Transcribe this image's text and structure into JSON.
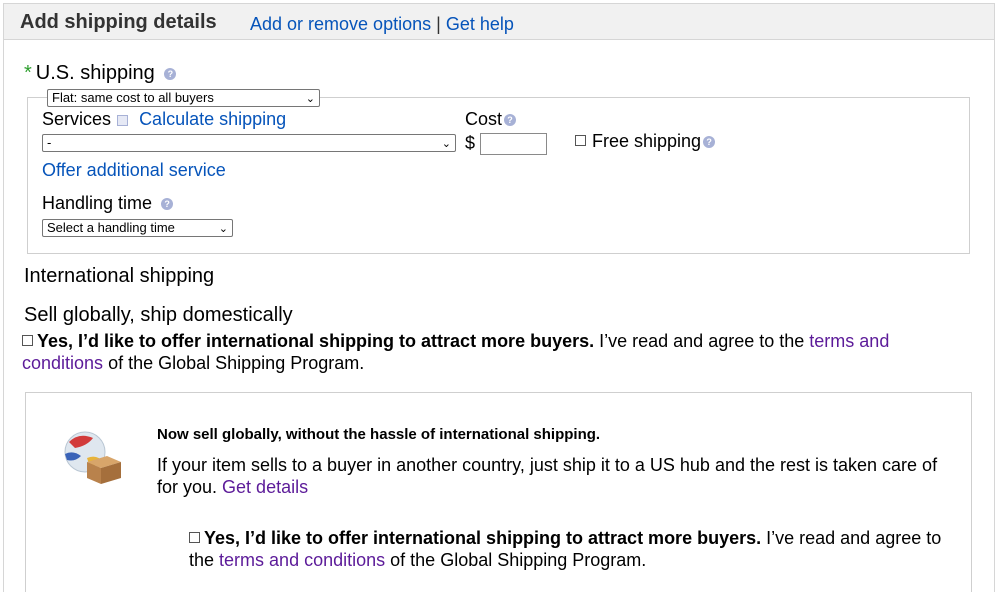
{
  "header": {
    "title": "Add shipping details",
    "add_remove": "Add or remove options",
    "separator": "|",
    "get_help": "Get help"
  },
  "us_shipping": {
    "required_mark": "*",
    "label": "U.S. shipping",
    "type_select": "Flat: same cost to all buyers",
    "services_label": "Services",
    "calculate_link": "Calculate shipping",
    "services_select": "-",
    "cost_label": "Cost",
    "currency": "$",
    "cost_value": "",
    "free_shipping_label": "Free shipping",
    "offer_additional": "Offer additional service",
    "handling_label": "Handling time",
    "handling_select": "Select a handling time"
  },
  "international": {
    "title": "International shipping",
    "sell_title": "Sell globally, ship domestically",
    "gsp_bold": "Yes, I’d like to offer international shipping to attract more buyers.",
    "gsp_text": "I’ve read and agree to the",
    "gsp_link": "terms and conditions",
    "gsp_suffix": "of the Global Shipping Program."
  },
  "promo": {
    "heading": "Now sell globally, without the hassle of international shipping.",
    "body": "If your item sells to a buyer in another country, just ship it to a US hub and the rest is taken care of for you.",
    "details_link": "Get details",
    "check_bold": "Yes, I’d like to offer international shipping to attract more buyers.",
    "check_text": "I’ve read and agree to the",
    "check_link": "terms and conditions",
    "check_suffix": "of the Global Shipping Program."
  },
  "icons": {
    "help": "help-icon",
    "calculator": "calculator-icon",
    "globe_package": "globe-package-icon"
  }
}
